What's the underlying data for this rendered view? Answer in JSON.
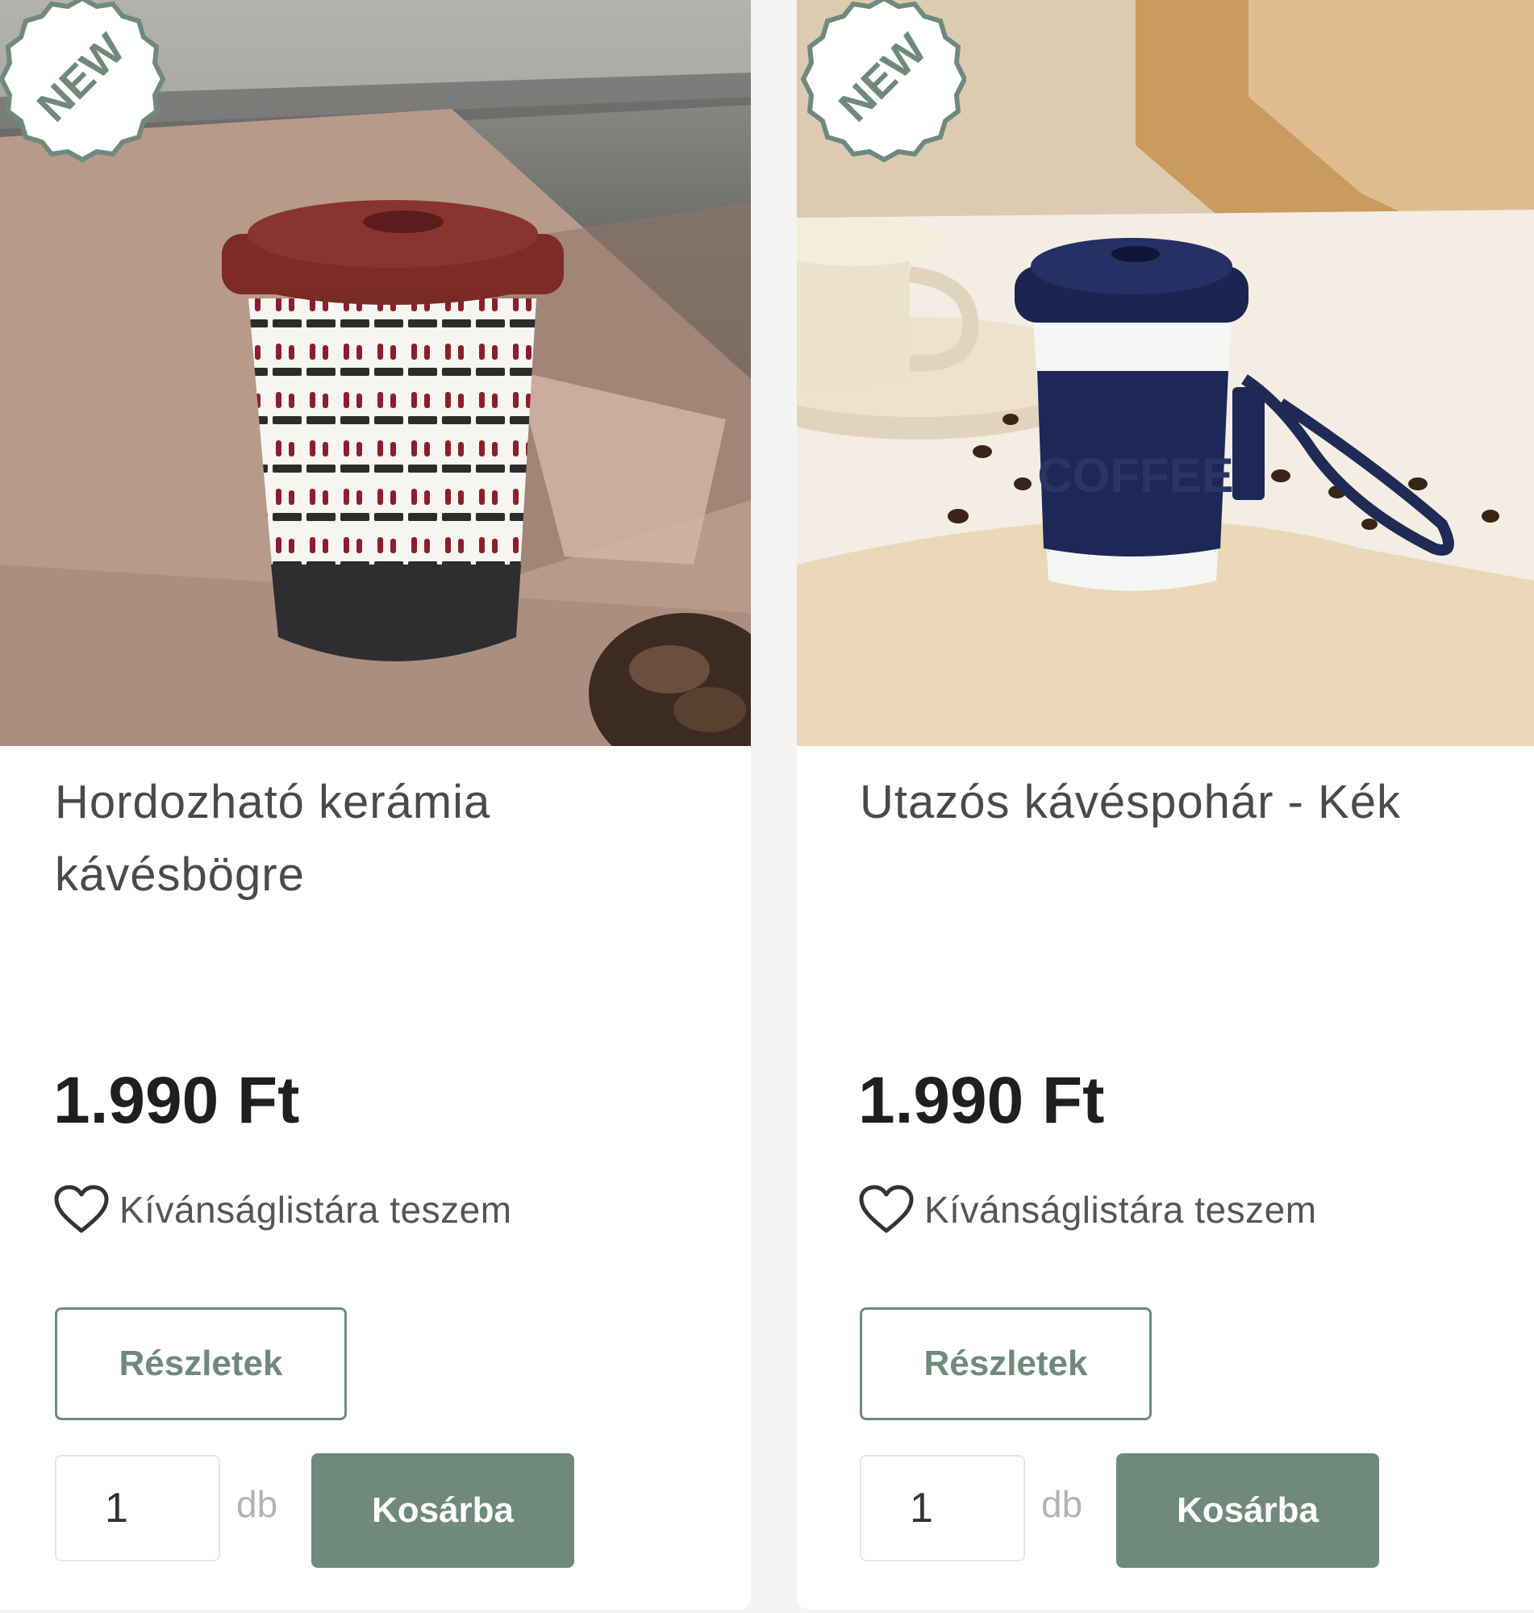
{
  "products": [
    {
      "badge": "NEW",
      "title": "Hordozható kerámia kávésbögre",
      "price": "1.990 Ft",
      "wishlist_label": "Kívánságlistára teszem",
      "details_label": "Részletek",
      "quantity": "1",
      "unit": "db",
      "cart_label": "Kosárba",
      "image_icon": "ceramic-cup-photo"
    },
    {
      "badge": "NEW",
      "title": "Utazós kávéspohár - Kék",
      "price": "1.990 Ft",
      "wishlist_label": "Kívánságlistára teszem",
      "details_label": "Részletek",
      "quantity": "1",
      "unit": "db",
      "cart_label": "Kosárba",
      "image_icon": "travel-cup-photo",
      "image_text": "COFFEE"
    }
  ],
  "colors": {
    "accent": "#6f8a7c",
    "page_bg": "#f4f4f4",
    "card_bg": "#ffffff"
  }
}
